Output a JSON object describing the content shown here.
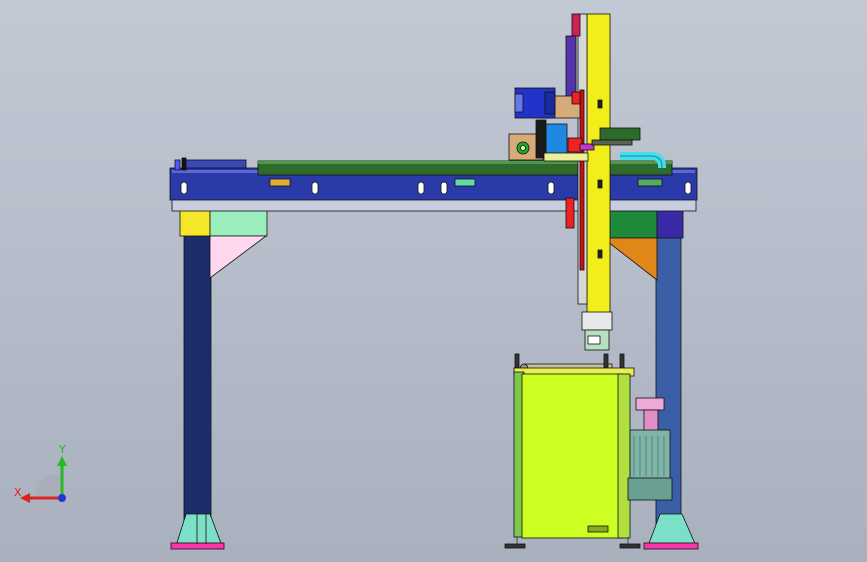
{
  "viewport": {
    "background_top": "#c2c8d4",
    "background_bottom": "#a9b0be"
  },
  "model": {
    "name": "",
    "colors": {
      "beam_blue": "#2a3aa8",
      "column_navy": "#1d2d6b",
      "column_steel": "#3b5fa6",
      "rail_green": "#2e6b2a",
      "mast_yellow": "#f2ee1a",
      "cabinet_lime": "#ccff22",
      "bracket_pink": "#ff33aa",
      "wedge_orange": "#e0871a",
      "motor_blue": "#2233cc",
      "pipe_cyan": "#44ddee",
      "motor_teal": "#7fb4a8"
    }
  },
  "triad": {
    "x_label": "X",
    "y_label": "Y",
    "x_color": "#dd2222",
    "y_color": "#22bb22",
    "z_color": "#2233dd"
  }
}
